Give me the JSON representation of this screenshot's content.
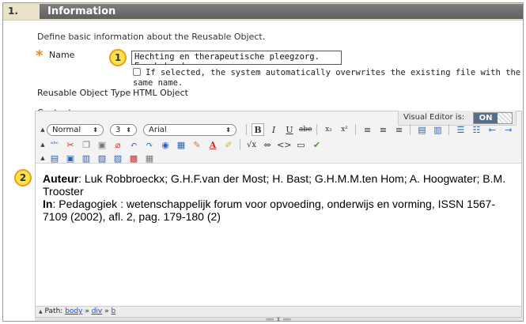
{
  "section": {
    "number": "1.",
    "title": "Information",
    "description": "Define basic information about the Reusable Object."
  },
  "name_field": {
    "required_mark": "*",
    "label": "Name",
    "value": "Hechting en therapeutische pleegzorg. Een behande",
    "overwrite_label": "If selected, the system automatically overwrites the existing file with the same name."
  },
  "reusable_object_type": {
    "label": "Reusable Object Type",
    "value": "HTML Object"
  },
  "content": {
    "label": "Content",
    "visual_editor": {
      "label": "Visual Editor is:",
      "state": "ON"
    },
    "toolbar": {
      "format_select": "Normal",
      "size_select": "3",
      "font_select": "Arial"
    },
    "body": {
      "auteur_label": "Auteur",
      "auteur_text": ": Luk Robbroeckx; G.H.F.van der Most; H. Bast; G.H.M.M.ten Hom; A. Hoogwater; B.M. Trooster",
      "in_label": "In",
      "in_text": ": Pedagogiek : wetenschappelijk forum voor opvoeding, onderwijs en vorming, ISSN 1567-7109 (2002), afl. 2, pag. 179-180 (2)"
    },
    "status": {
      "path_label": "Path:",
      "path_items": [
        "body",
        "div",
        "b"
      ],
      "separator": "»"
    }
  },
  "callouts": [
    "1",
    "2"
  ],
  "colors": {
    "header_bar": "#6f6f6f",
    "header_bg": "#e9e2c9",
    "required": "#f08a16",
    "callout_fill": "#fde24a",
    "link": "#1a4fd1"
  }
}
